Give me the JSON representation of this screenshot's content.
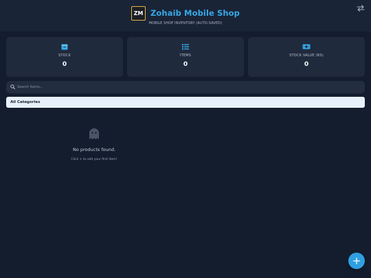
{
  "header": {
    "logo_text": "ZM",
    "title": "Zohaib Mobile Shop",
    "subtitle": "MOBILE SHOP INVENTORY (AUTO-SAVED)",
    "swap_icon": "swap-arrows-icon"
  },
  "stats": [
    {
      "label": "STOCK",
      "value": "0",
      "icon": "box-icon"
    },
    {
      "label": "ITEMS",
      "value": "0",
      "icon": "list-icon"
    },
    {
      "label": "STOCK VALUE (RS)",
      "value": "0",
      "icon": "money-icon"
    }
  ],
  "search": {
    "placeholder": "Search items..."
  },
  "category": {
    "selected": "All Categories"
  },
  "empty": {
    "icon": "ghost-icon",
    "title": "No products found.",
    "hint": "Click + to add your first item!"
  },
  "fab": {
    "label": "+"
  },
  "colors": {
    "background": "#141d2e",
    "header": "#1a2437",
    "card": "#1f2a3c",
    "accent": "#38a9e8",
    "fab": "#2f9fe0",
    "logo_border": "#e2b64a"
  }
}
